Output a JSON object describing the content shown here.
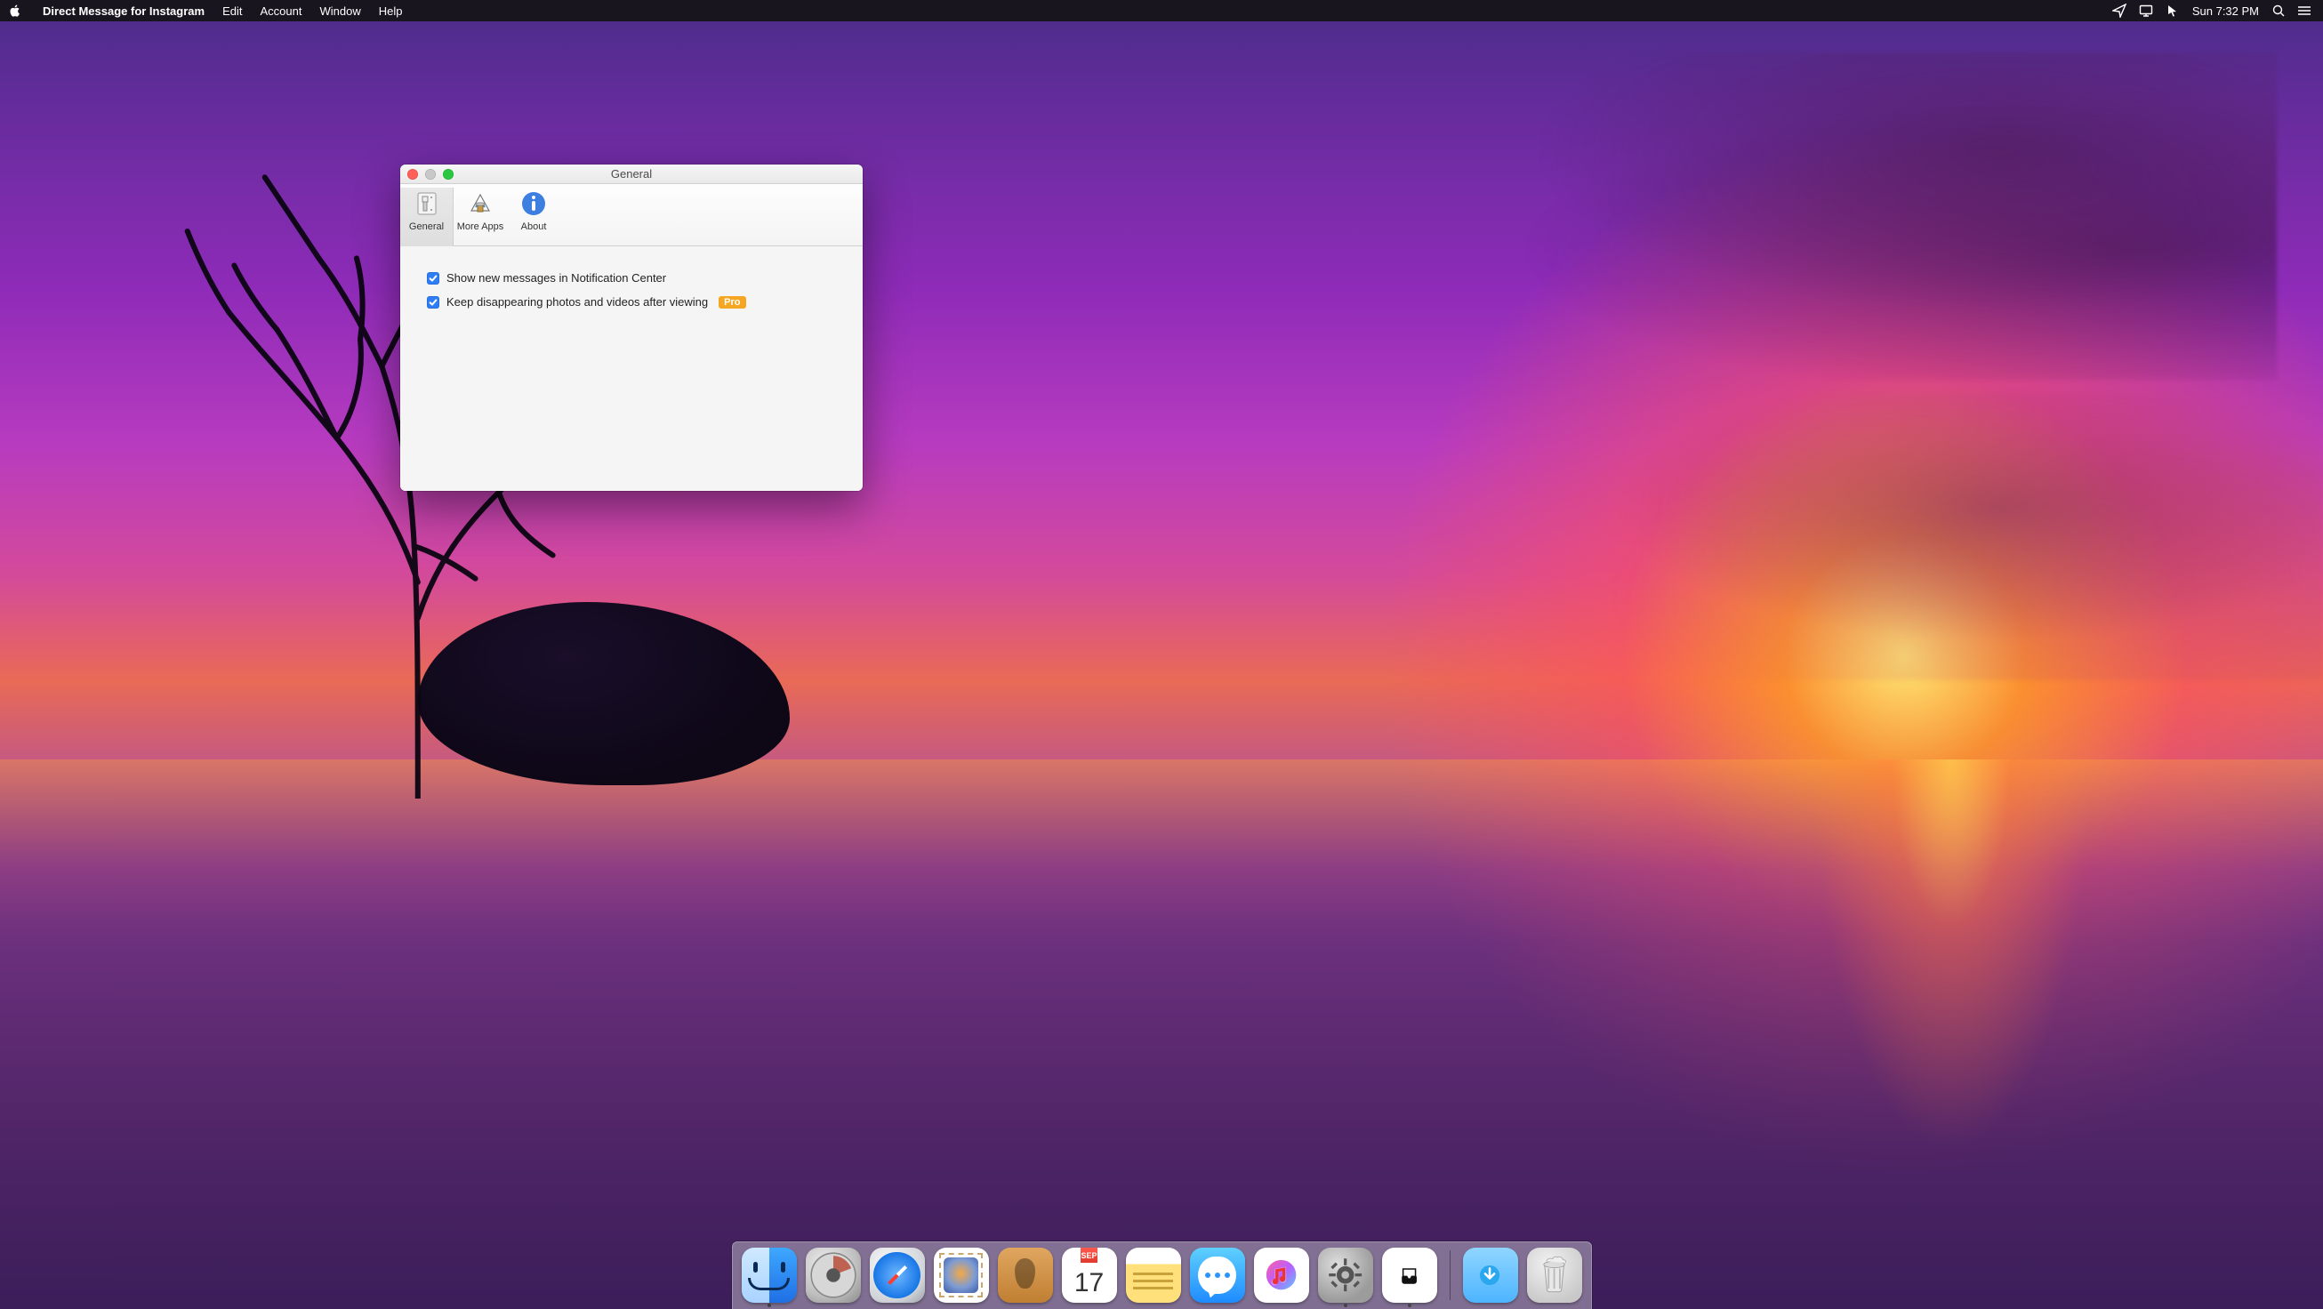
{
  "menubar": {
    "app_name": "Direct Message for Instagram",
    "items": [
      "Edit",
      "Account",
      "Window",
      "Help"
    ],
    "clock": "Sun 7:32 PM"
  },
  "window": {
    "title": "General",
    "toolbar": [
      {
        "label": "General",
        "selected": true
      },
      {
        "label": "More Apps",
        "selected": false
      },
      {
        "label": "About",
        "selected": false
      }
    ],
    "prefs": {
      "opt_notifications": {
        "label": "Show new messages in Notification Center",
        "checked": true
      },
      "opt_keep_media": {
        "label": "Keep disappearing photos and videos after viewing",
        "checked": true,
        "badge": "Pro"
      }
    }
  },
  "calendar": {
    "month": "SEP",
    "day": "17"
  },
  "dock": {
    "items": [
      {
        "name": "finder",
        "running": true
      },
      {
        "name": "launchpad",
        "running": false
      },
      {
        "name": "safari",
        "running": false
      },
      {
        "name": "mail",
        "running": false
      },
      {
        "name": "contacts",
        "running": false
      },
      {
        "name": "calendar",
        "running": false
      },
      {
        "name": "notes",
        "running": false
      },
      {
        "name": "messages",
        "running": false
      },
      {
        "name": "itunes",
        "running": false
      },
      {
        "name": "system-preferences",
        "running": true
      },
      {
        "name": "direct-message",
        "running": true
      }
    ],
    "extras": [
      {
        "name": "downloads"
      },
      {
        "name": "trash"
      }
    ]
  }
}
